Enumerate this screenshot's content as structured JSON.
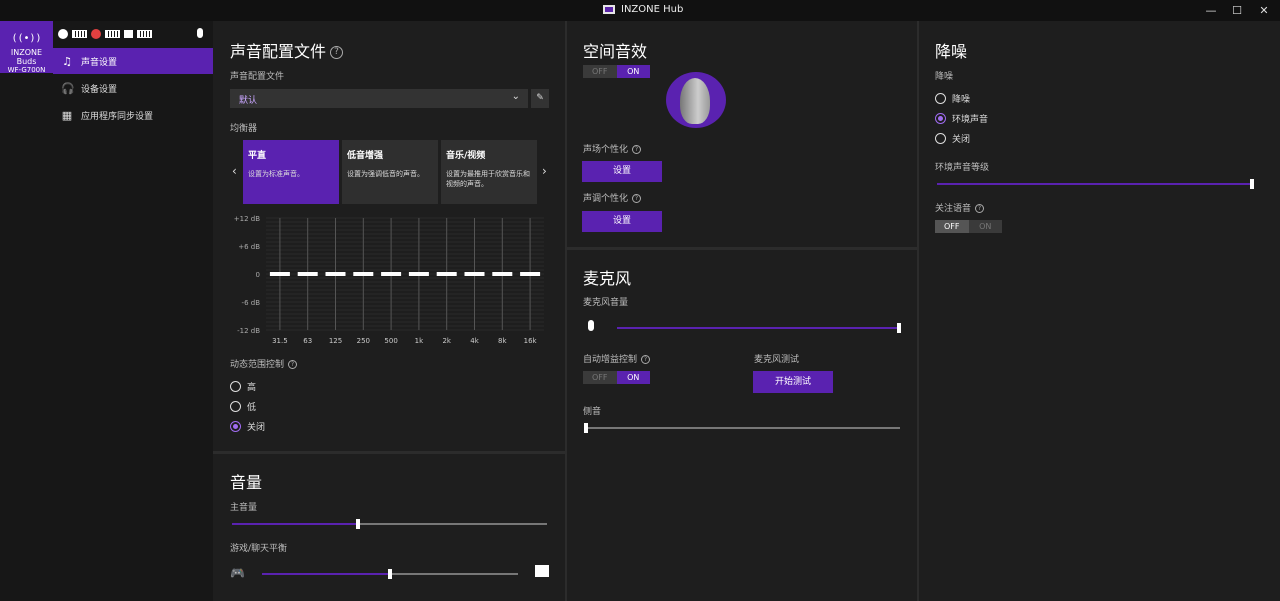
{
  "window": {
    "title": "INZONE Hub",
    "minimize": "—",
    "maximize": "☐",
    "close": "✕"
  },
  "device": {
    "name": "INZONE Buds",
    "model": "WF-G700N",
    "icon": "((•))"
  },
  "nav": [
    {
      "label": "声音设置",
      "icon": "♫"
    },
    {
      "label": "设备设置",
      "icon": "🎧"
    },
    {
      "label": "应用程序同步设置",
      "icon": "▦"
    }
  ],
  "sound_profile": {
    "title": "声音配置文件",
    "profile_label": "声音配置文件",
    "profile_value": "默认",
    "eq_label": "均衡器",
    "presets": [
      {
        "title": "平直",
        "desc": "设置为标准声音。"
      },
      {
        "title": "低音增强",
        "desc": "设置为强调低音的声音。"
      },
      {
        "title": "音乐/视频",
        "desc": "设置为最推用于欣赏音乐和视频的声音。"
      }
    ],
    "db_labels": [
      "+12 dB",
      "+6 dB",
      "0",
      "-6 dB",
      "-12 dB"
    ],
    "bands": [
      "31.5",
      "63",
      "125",
      "250",
      "500",
      "1k",
      "2k",
      "4k",
      "8k",
      "16k"
    ],
    "band_gains_db": [
      0,
      0,
      0,
      0,
      0,
      0,
      0,
      0,
      0,
      0
    ],
    "drc_label": "动态范围控制",
    "drc_options": [
      "高",
      "低",
      "关闭"
    ],
    "drc_selected": "关闭"
  },
  "volume": {
    "title": "音量",
    "master_label": "主音量",
    "master_value": 0.4,
    "balance_label": "游戏/聊天平衡",
    "balance_value": 0.5
  },
  "spatial": {
    "title": "空间音效",
    "toggle_off": "OFF",
    "toggle_on": "ON",
    "state": "on",
    "field_label": "声场个性化",
    "field_button": "设置",
    "tone_label": "声调个性化",
    "tone_button": "设置"
  },
  "mic": {
    "title": "麦克风",
    "volume_label": "麦克风音量",
    "volume_value": 1.0,
    "agc_label": "自动增益控制",
    "agc_off": "OFF",
    "agc_on": "ON",
    "agc_state": "on",
    "test_label": "麦克风测试",
    "test_button": "开始测试",
    "sidetone_label": "侧音",
    "sidetone_value": 0.0
  },
  "nc": {
    "title": "降噪",
    "mode_label": "降噪",
    "options": [
      "降噪",
      "环境声音",
      "关闭"
    ],
    "selected": "环境声音",
    "ambient_level_label": "环境声音等级",
    "ambient_level_value": 1.0,
    "voice_focus_label": "关注语音",
    "voice_off": "OFF",
    "voice_on": "ON",
    "voice_state": "off"
  },
  "colors": {
    "accent": "#5a22b0",
    "accent_light": "#a06cf0",
    "background": "#1e1e1e"
  }
}
